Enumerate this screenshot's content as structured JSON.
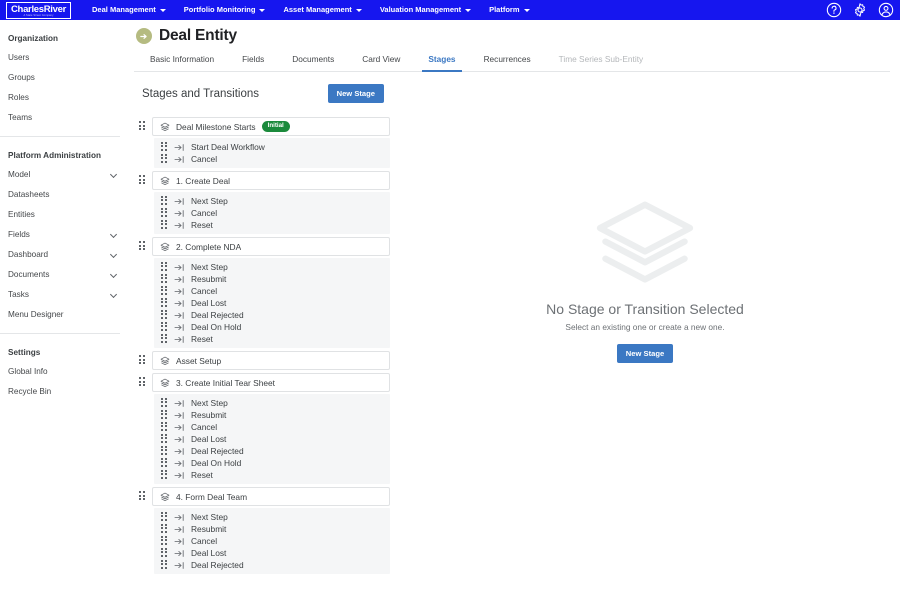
{
  "topnav": {
    "logo_main": "CharlesRiver",
    "logo_sub": "A State Street Company",
    "items": [
      {
        "label": "Deal Management",
        "has_caret": true
      },
      {
        "label": "Portfolio Monitoring",
        "has_caret": true
      },
      {
        "label": "Asset Management",
        "has_caret": true
      },
      {
        "label": "Valuation Management",
        "has_caret": true
      },
      {
        "label": "Platform",
        "has_caret": true
      }
    ],
    "icons": [
      "help-circle-icon",
      "gear-icon",
      "user-avatar-icon"
    ],
    "bg_color": "#1616ef"
  },
  "sidebar": {
    "sections": [
      {
        "title": "Organization",
        "items": [
          {
            "label": "Users",
            "chevron": false
          },
          {
            "label": "Groups",
            "chevron": false
          },
          {
            "label": "Roles",
            "chevron": false
          },
          {
            "label": "Teams",
            "chevron": false
          }
        ]
      },
      {
        "title": "Platform Administration",
        "items": [
          {
            "label": "Model",
            "chevron": true
          },
          {
            "label": "Datasheets",
            "chevron": false
          },
          {
            "label": "Entities",
            "chevron": false
          },
          {
            "label": "Fields",
            "chevron": true
          },
          {
            "label": "Dashboard",
            "chevron": true
          },
          {
            "label": "Documents",
            "chevron": true
          },
          {
            "label": "Tasks",
            "chevron": true
          },
          {
            "label": "Menu Designer",
            "chevron": false
          }
        ]
      },
      {
        "title": "Settings",
        "items": [
          {
            "label": "Global Info",
            "chevron": false
          },
          {
            "label": "Recycle Bin",
            "chevron": false
          }
        ]
      }
    ]
  },
  "page": {
    "title": "Deal Entity",
    "entity_icon_color": "#b5bb81",
    "tabs": [
      {
        "label": "Basic Information",
        "active": false,
        "disabled": false
      },
      {
        "label": "Fields",
        "active": false,
        "disabled": false
      },
      {
        "label": "Documents",
        "active": false,
        "disabled": false
      },
      {
        "label": "Card View",
        "active": false,
        "disabled": false
      },
      {
        "label": "Stages",
        "active": true,
        "disabled": false
      },
      {
        "label": "Recurrences",
        "active": false,
        "disabled": false
      },
      {
        "label": "Time Series Sub-Entity",
        "active": false,
        "disabled": true
      }
    ],
    "accent_color": "#3b78c3"
  },
  "stages_panel": {
    "heading": "Stages and Transitions",
    "new_stage_label": "New Stage",
    "stages": [
      {
        "name": "Deal Milestone Starts",
        "badge": "Initial",
        "badge_color": "#1b8a3c",
        "transitions": [
          "Start Deal Workflow",
          "Cancel"
        ]
      },
      {
        "name": "1. Create Deal",
        "badge": null,
        "transitions": [
          "Next Step",
          "Cancel",
          "Reset"
        ]
      },
      {
        "name": "2. Complete NDA",
        "badge": null,
        "transitions": [
          "Next Step",
          "Resubmit",
          "Cancel",
          "Deal Lost",
          "Deal Rejected",
          "Deal On Hold",
          "Reset"
        ]
      },
      {
        "name": "Asset Setup",
        "badge": null,
        "transitions": []
      },
      {
        "name": "3. Create Initial Tear Sheet",
        "badge": null,
        "transitions": [
          "Next Step",
          "Resubmit",
          "Cancel",
          "Deal Lost",
          "Deal Rejected",
          "Deal On Hold",
          "Reset"
        ]
      },
      {
        "name": "4. Form Deal Team",
        "badge": null,
        "transitions": [
          "Next Step",
          "Resubmit",
          "Cancel",
          "Deal Lost",
          "Deal Rejected"
        ]
      }
    ]
  },
  "empty_state": {
    "title": "No Stage or Transition Selected",
    "subtitle": "Select an existing one or create a new one.",
    "button_label": "New Stage",
    "icon": "layers-stack-icon"
  }
}
